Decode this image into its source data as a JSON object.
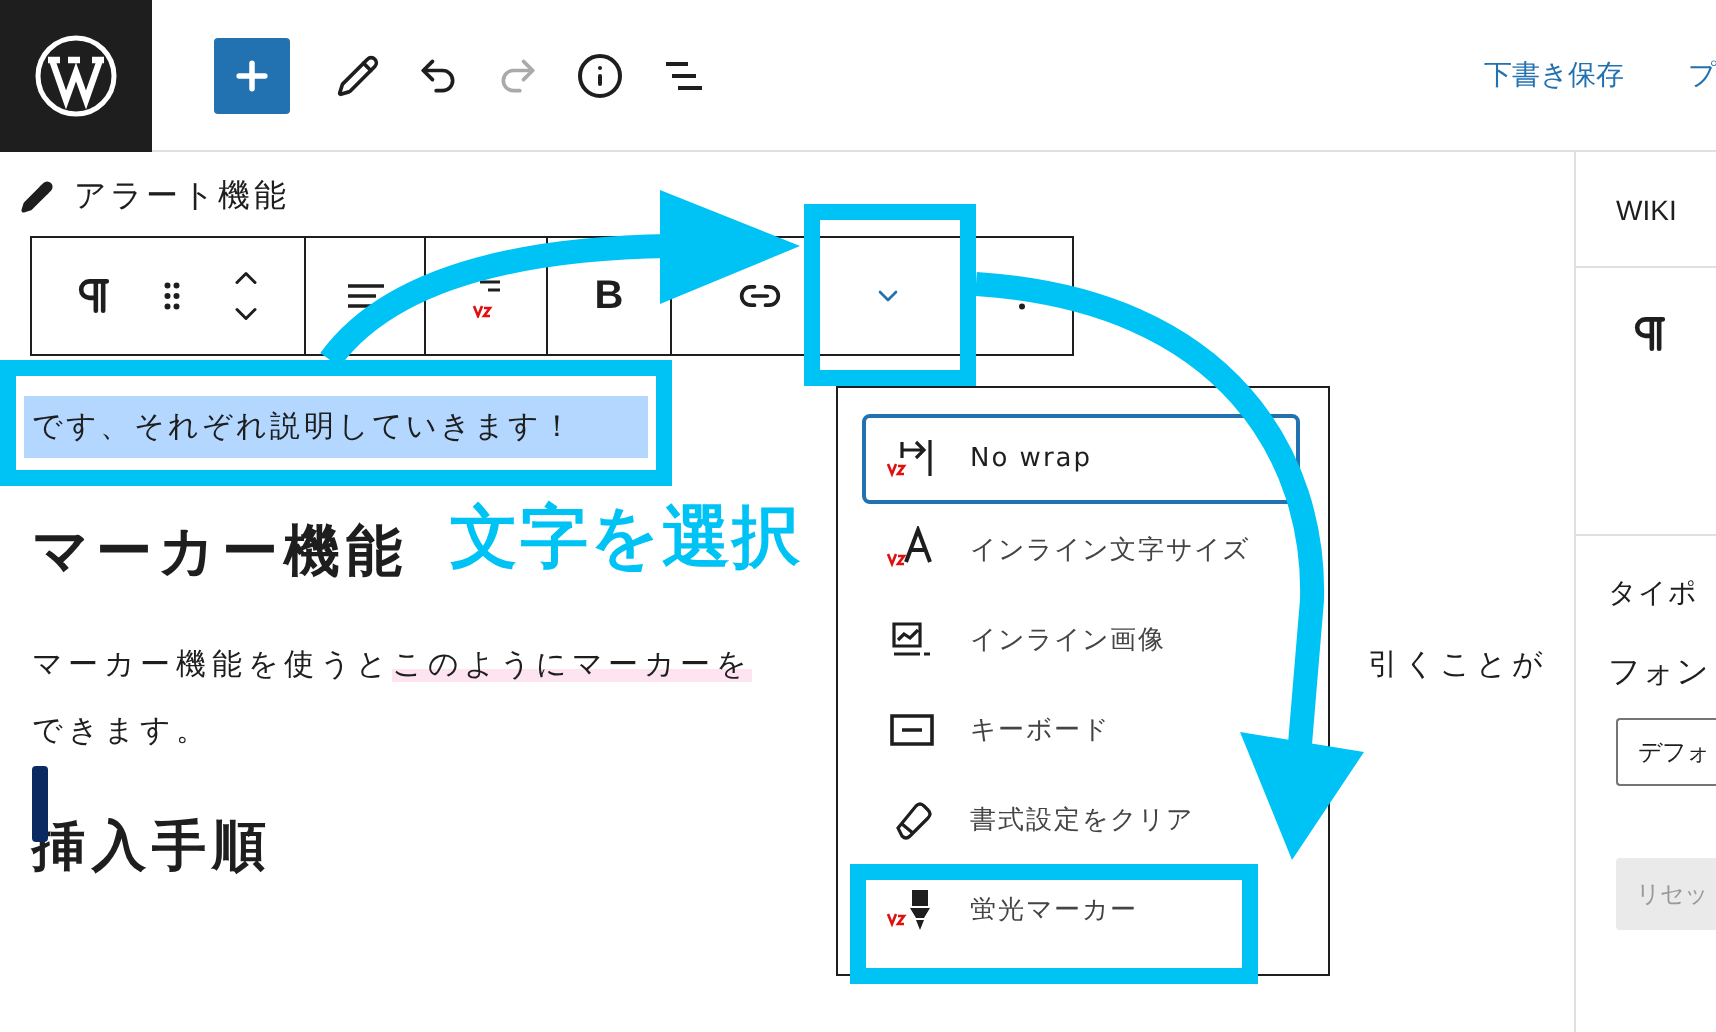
{
  "top_bar": {
    "save_draft": "下書き保存",
    "preview": "プ"
  },
  "breadcrumb": "アラート機能",
  "block_toolbar": {
    "bold_label": "B",
    "more_formats": {
      "expanded": true
    }
  },
  "selected_text": "です、それぞれ説明していきます！",
  "content": [
    {
      "kind": "heading",
      "text": "マーカー機能",
      "cursor": false
    },
    {
      "kind": "paragraph",
      "lines": [
        {
          "left": [
            {
              "text": "マーカー機能を使うと",
              "marked": false
            },
            {
              "text": "このようにマーカーを",
              "marked": true
            }
          ],
          "right": "引くことが"
        },
        {
          "left": [
            {
              "text": "できます。",
              "marked": false
            }
          ]
        }
      ]
    },
    {
      "kind": "heading",
      "text": "挿入手順",
      "cursor": true
    }
  ],
  "format_menu": {
    "items": [
      {
        "kind": "nowrap",
        "label": "No wrap",
        "selected": true
      },
      {
        "kind": "font-size",
        "label": "インライン文字サイズ",
        "selected": false
      },
      {
        "kind": "image",
        "label": "インライン画像",
        "selected": false
      },
      {
        "kind": "keyboard",
        "label": "キーボード",
        "selected": false
      },
      {
        "kind": "eraser",
        "label": "書式設定をクリア",
        "selected": false
      },
      {
        "kind": "marker",
        "label": "蛍光マーカー",
        "selected": false
      }
    ]
  },
  "sidebar": {
    "tab": "WIKI",
    "section_label": "タイポ",
    "font_label": "フォン",
    "font_select": "デフォ",
    "reset_button": {
      "label": "リセッ",
      "disabled": true
    }
  },
  "annotations": {
    "label": "文字を選択"
  }
}
